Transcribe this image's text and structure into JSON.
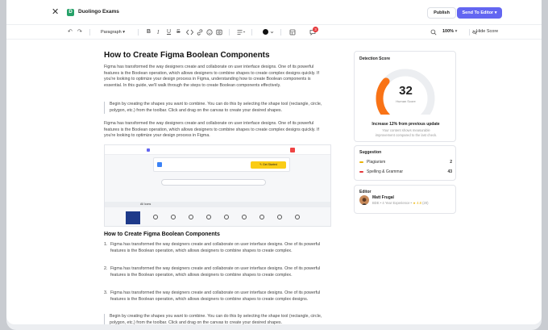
{
  "app": {
    "title": "Duolingo Exams",
    "logo_letter": "D",
    "close": "✕"
  },
  "header": {
    "publish_label": "Publish",
    "send_label": "Send To Editor",
    "send_chevron": "▾"
  },
  "toolbar": {
    "undo": "↶",
    "redo": "↷",
    "paragraph_label": "Paragraph",
    "paragraph_chevron": "▾",
    "bold": "B",
    "italic": "I",
    "underline": "U",
    "strike": "S",
    "notifications_count": "3",
    "zoom": "100%",
    "zoom_chevron": "▾",
    "hide_score_label": "Hide Score"
  },
  "doc": {
    "title": "How to Create Figma Boolean Components",
    "p1": "Figma has transformed the way designers create and collaborate on user interface designs. One of its powerful features is the Boolean operation, which allows designers to combine shapes to create complex designs quickly. If you're looking to optimize your design process in Figma, understanding how to create Boolean components is essential. In this guide, we'll walk through the steps to create Boolean components effectively.",
    "quote1": "Begin by creating the shapes you want to combine. You can do this by selecting the shape tool (rectangle, circle, polygon, etc.) from the toolbar. Click and drag on the canvas to create your desired shapes.",
    "p2": "Figma has transformed the way designers create and collaborate on user interface designs. One of its powerful features is the Boolean operation, which allows designers to combine shapes to create complex designs quickly. If you're looking to optimize your design process in Figma.",
    "h2": "How to Create Figma Boolean Components",
    "list": [
      {
        "n": "1.",
        "text": "Figma has transformed the way designers create and collaborate on user interface designs. One of its powerful features is the Boolean operation, which allows designers to combine shapes to create complex."
      },
      {
        "n": "2.",
        "text": "Figma has transformed the way designers create and collaborate on user interface designs. One of its powerful features is the Boolean operation, which allows designers to combine shapes to create complex."
      },
      {
        "n": "3.",
        "text": "Figma has transformed the way designers create and collaborate on user interface designs. One of its powerful features is the Boolean operation, which allows designers to combine shapes to create complex designs."
      }
    ],
    "quote2": "Begin by creating the shapes you want to combine. You can do this by selecting the shape tool (rectangle, circle, polygon, etc.) from the toolbar. Click and drag on the canvas to create your desired shapes."
  },
  "screenshot": {
    "banner_button": "✎ Get Started",
    "all_icons": "All Icons"
  },
  "detection": {
    "title": "Detection Score",
    "score": "32",
    "score_fraction": 0.32,
    "score_label": "Human Score",
    "increase": "Increase 12% from previous update",
    "increase_sub": "Your content shows measurable improvement compared to the last check.",
    "accent": "#f97316",
    "track": "#eceef1"
  },
  "suggestion": {
    "title": "Suggestion",
    "items": [
      {
        "label": "Plagiarism",
        "value": "2",
        "color": "#eab308"
      },
      {
        "label": "Spelling & Grammar",
        "value": "43",
        "color": "#e5383b"
      }
    ]
  },
  "editor": {
    "title": "Editor",
    "name": "Matt Frugal",
    "meta": "BDE • 4 Year Experience •",
    "rating": "★ 4.8",
    "rating_count": "(20)"
  }
}
